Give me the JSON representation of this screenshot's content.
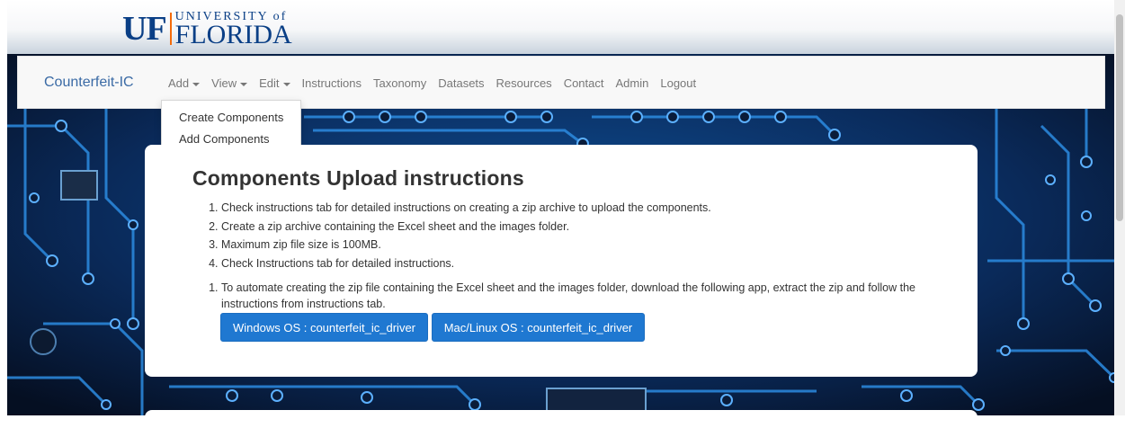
{
  "header": {
    "logo_uf": "UF",
    "logo_university": "UNIVERSITY of",
    "logo_florida": "FLORIDA"
  },
  "navbar": {
    "brand": "Counterfeit-IC",
    "items": [
      "Add",
      "View",
      "Edit",
      "Instructions",
      "Taxonomy",
      "Datasets",
      "Resources",
      "Contact",
      "Admin",
      "Logout"
    ]
  },
  "add_dropdown": {
    "items": [
      "Create Components",
      "Add Components"
    ]
  },
  "card": {
    "title": "Components Upload instructions",
    "steps": [
      "Check instructions tab for detailed instructions on creating a zip archive to upload the components.",
      "Create a zip archive containing the Excel sheet and the images folder.",
      "Maximum zip file size is 100MB.",
      "Check Instructions tab for detailed instructions."
    ],
    "automate_step": "To automate creating the zip file containing the Excel sheet and the images folder, download the following app, extract the zip and follow the instructions from instructions tab.",
    "buttons": {
      "windows": "Windows OS : counterfeit_ic_driver",
      "mac_linux": "Mac/Linux OS : counterfeit_ic_driver"
    }
  },
  "colors": {
    "uf_blue": "#0a3f86",
    "uf_orange": "#f46b0a",
    "button_blue": "#1f78d1",
    "brand_link": "#3a6aa5",
    "circuit_bg": "#081a36"
  }
}
